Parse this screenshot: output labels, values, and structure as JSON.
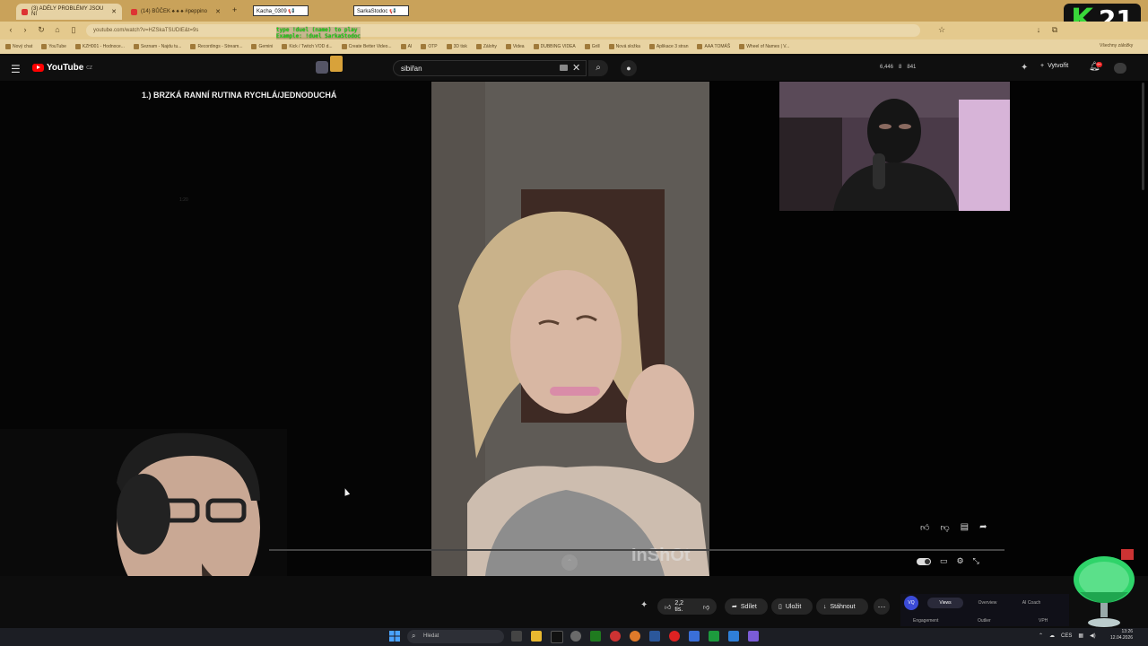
{
  "browser": {
    "tabs": [
      {
        "label": "(3) ADÉLY PROBLÉMY JSOU NI",
        "active": true
      },
      {
        "label": "(14) BŮČEK ♠ ♠ ♠ #peppino",
        "active": false
      }
    ],
    "overlay_badges": [
      "Kacha_0309 📢",
      "SarkaStodoc 📢"
    ],
    "url": "youtube.com/watch?v=HZSkaTSUDIE&t=9s",
    "bookmarks": [
      "Nový chat",
      "YouTube",
      "KZH001 - Hodnoce...",
      "Seznam - Najdu tu...",
      "Recordings - Stream...",
      "Gemini",
      "Kick / Twitch VOD d...",
      "Create Better Video...",
      "AI",
      "ОТР",
      "3D tisk",
      "Zálohy",
      "Videa",
      "DUBBING VIDEA",
      "Grill",
      "Nová složka",
      "Aplikace 3 stran",
      "AAA TOMÁŠ",
      "Wheel of Names | V..."
    ],
    "bookmarks_right": "Všechny záložky",
    "chat_command": [
      "type !duel (name) to play",
      "Example: !duel SarkaStodoc"
    ]
  },
  "stream_badge": {
    "letter": "K",
    "number": "21"
  },
  "youtube": {
    "logo": "YouTube",
    "region": "CZ",
    "search_value": "sibiřan",
    "stats": [
      "6,446",
      "8",
      "841"
    ],
    "create_label": "Vytvořit",
    "notifications": "9+",
    "video_title": "1.) BRZKÁ RANNÍ RUTINA RYCHLÁ/JEDNODUCHÁ",
    "overlay_time": "1:20",
    "watermark": "InShOt",
    "like_count": "2,2 tis.",
    "share_label": "Sdílet",
    "save_label": "Uložit",
    "download_label": "Stáhnout",
    "analytics": {
      "logo": "VQ",
      "tabs": [
        "Views",
        "Overview",
        "AI Coach"
      ],
      "sub": [
        "Engagement",
        "Outlier",
        "VPH"
      ]
    }
  },
  "taskbar": {
    "search": "Hledat",
    "lang": "CES",
    "time": "13:26",
    "date": "12.04.2026"
  },
  "colors": {
    "accent": "#ff0000",
    "tabbar": "#c9a25a",
    "badge_green": "#39d83a"
  }
}
